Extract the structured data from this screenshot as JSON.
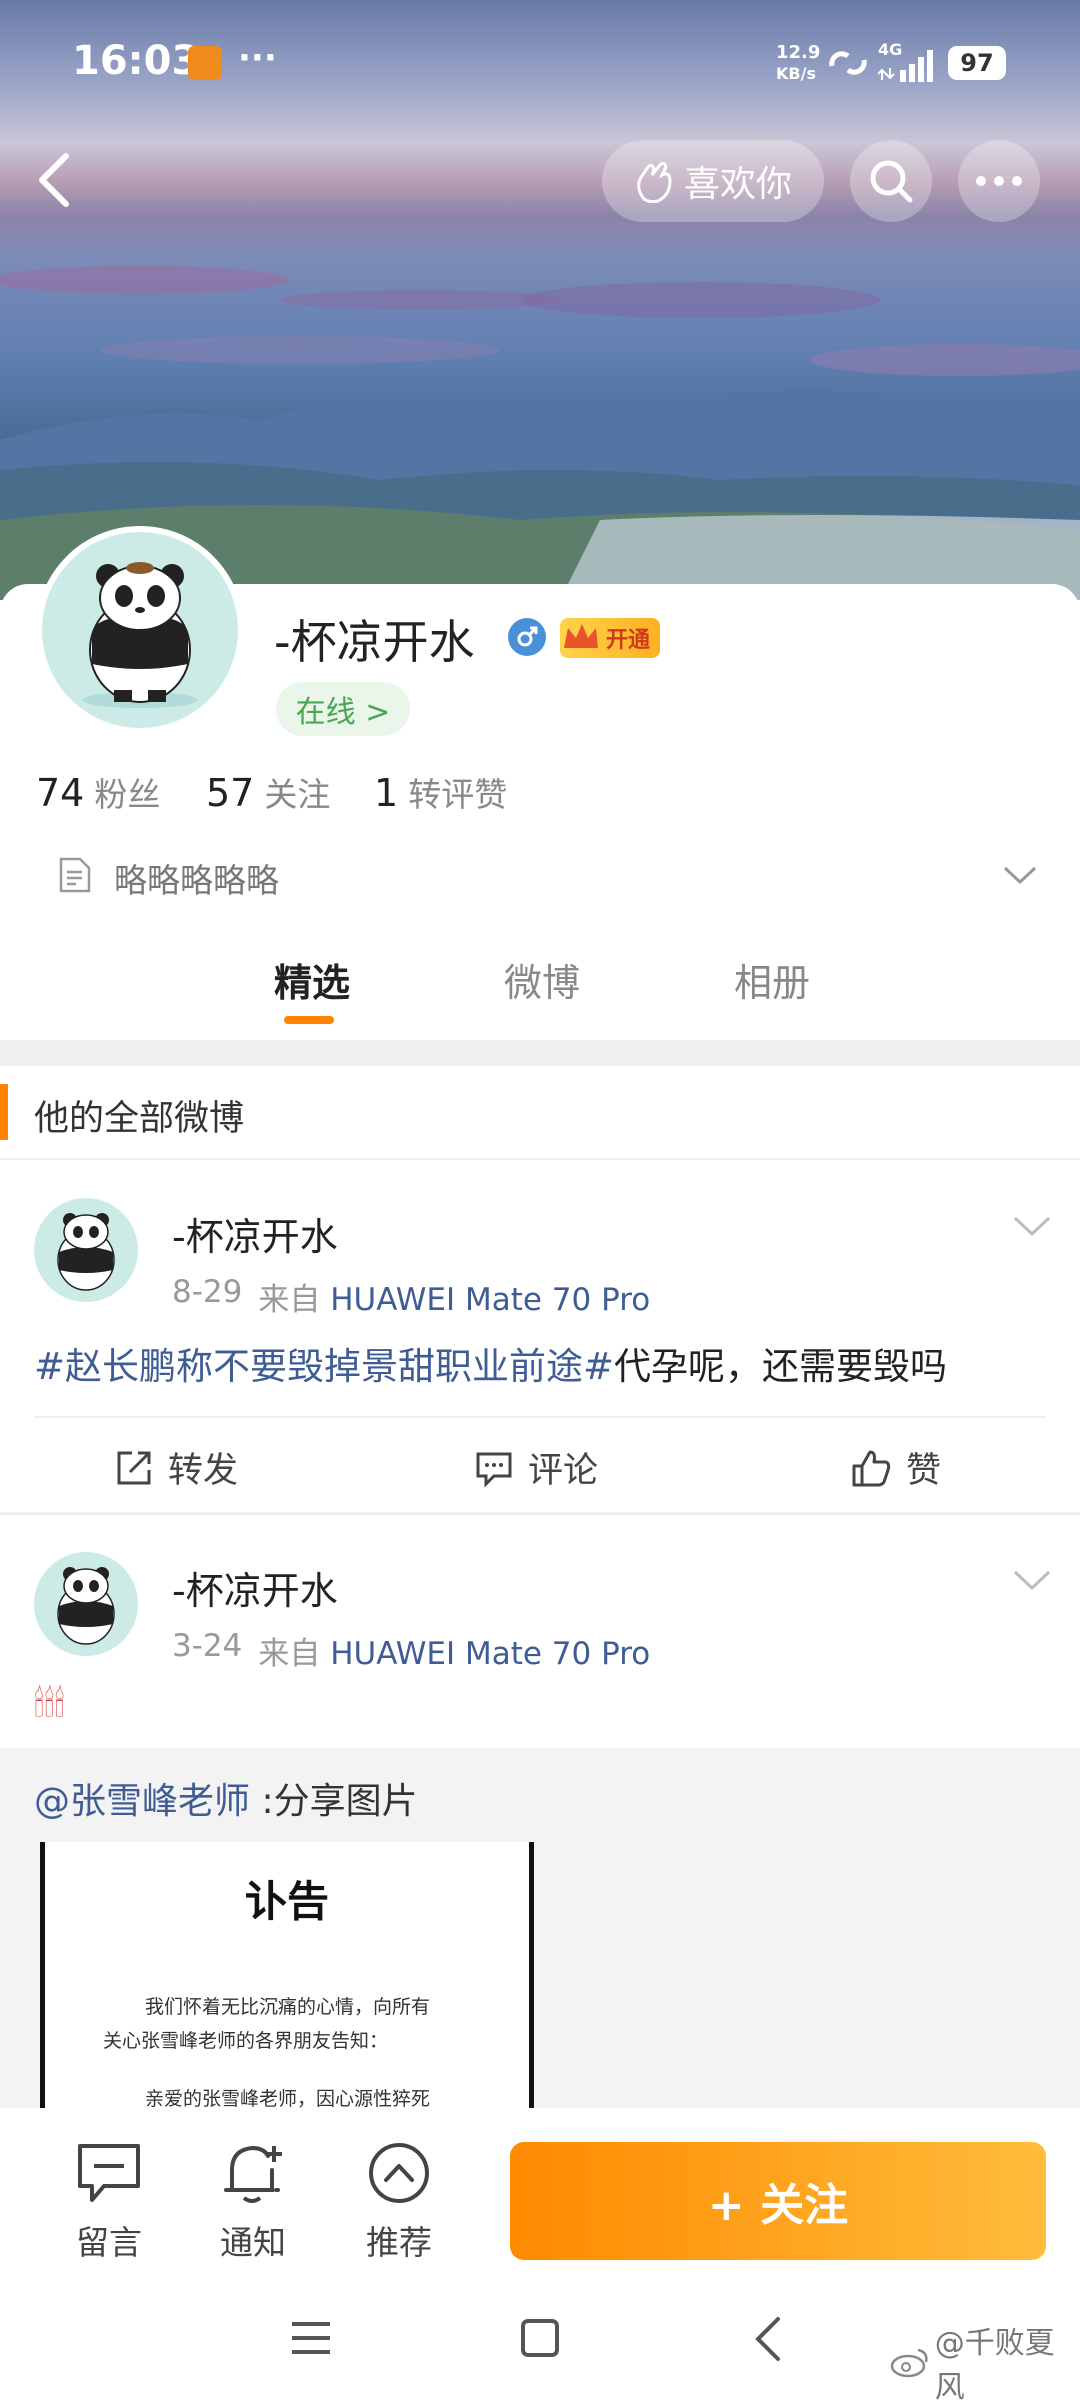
{
  "status_bar": {
    "time": "16:03",
    "dots": "···",
    "net_speed": "12.9",
    "net_unit": "KB/s",
    "signal": "4G",
    "battery": "97"
  },
  "header": {
    "like_label": "喜欢你"
  },
  "profile": {
    "name": "-杯凉开水",
    "vip_label": "开通",
    "online_label": "在线 >",
    "stats": [
      {
        "num": "74",
        "label": "粉丝"
      },
      {
        "num": "57",
        "label": "关注"
      },
      {
        "num": "1",
        "label": "转评赞"
      }
    ],
    "bio": "略略略略略"
  },
  "tabs": [
    "精选",
    "微博",
    "相册"
  ],
  "section_title": "他的全部微博",
  "posts": [
    {
      "name": "-杯凉开水",
      "date": "8-29",
      "from": "来自",
      "device": "HUAWEI Mate 70 Pro",
      "hashtag": "#赵长鹏称不要毁掉景甜职业前途#",
      "text": "代孕呢，还需要毁吗",
      "actions": [
        "转发",
        "评论",
        "赞"
      ]
    },
    {
      "name": "-杯凉开水",
      "date": "3-24",
      "from": "来自",
      "device": "HUAWEI Mate 70 Pro",
      "emoji": "🕯🕯🕯",
      "repost_user": "@张雪峰老师",
      "repost_text": " :分享图片",
      "notice_title": "讣告",
      "notice_lines": [
        "我们怀着无比沉痛的心情，向所有",
        "关心张雪峰老师的各界朋友告知：",
        "亲爱的张雪峰老师，因心源性猝死"
      ]
    }
  ],
  "bottom_bar": {
    "items": [
      "留言",
      "通知",
      "推荐"
    ],
    "follow_label": "+ 关注"
  },
  "watermark": "@千败夏风",
  "colors": {
    "accent": "#ff8200",
    "link": "#3f5d94"
  }
}
